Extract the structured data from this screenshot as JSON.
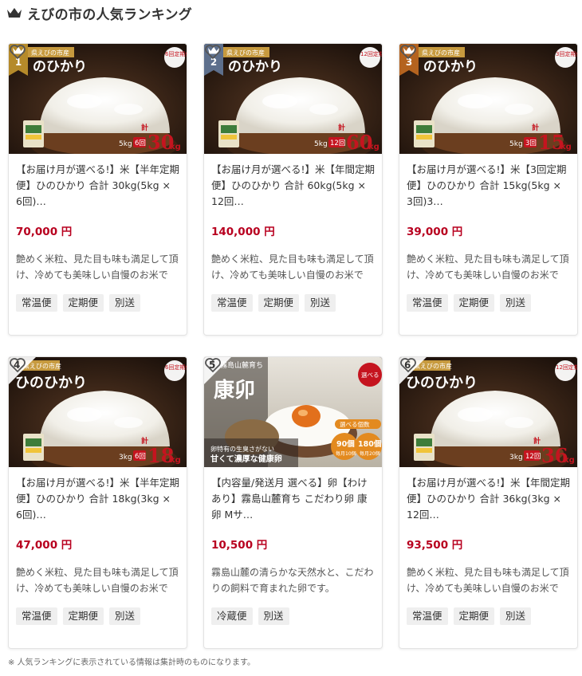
{
  "header": {
    "title": "えびの市の人気ランキング"
  },
  "colors": {
    "price": "#b8001f",
    "gold": "#b58a2a",
    "silver": "#5d6f8c",
    "bronze": "#b4631f"
  },
  "cards": [
    {
      "rank": "1",
      "rank_style": "gold",
      "image": {
        "brand": "県えびの市産",
        "name": "のひかり",
        "sub": "6回定期便",
        "unit": "5kg",
        "times": "6回",
        "total_prefix": "計",
        "total": "30",
        "total_unit": "kg"
      },
      "title": "【お届け月が選べる!】米【半年定期便】ひのひかり 合計 30kg(5kg × 6回)…",
      "price": "70,000 円",
      "desc": "艶めく米粒、見た目も味も満足して頂け、冷めても美味しい自慢のお米です。",
      "tags": [
        "常温便",
        "定期便",
        "別送"
      ]
    },
    {
      "rank": "2",
      "rank_style": "silver",
      "image": {
        "brand": "県えびの市産",
        "name": "のひかり",
        "sub": "12回定期便",
        "unit": "5kg",
        "times": "12回",
        "total_prefix": "計",
        "total": "60",
        "total_unit": "kg"
      },
      "title": "【お届け月が選べる!】米【年間定期便】ひのひかり 合計 60kg(5kg × 12回…",
      "price": "140,000 円",
      "desc": "艶めく米粒、見た目も味も満足して頂け、冷めても美味しい自慢のお米です。",
      "tags": [
        "常温便",
        "定期便",
        "別送"
      ]
    },
    {
      "rank": "3",
      "rank_style": "bronze",
      "image": {
        "brand": "県えびの市産",
        "name": "のひかり",
        "sub": "3回定期便",
        "unit": "5kg",
        "times": "3回",
        "total_prefix": "計",
        "total": "15",
        "total_unit": "kg"
      },
      "title": "【お届け月が選べる!】米【3回定期便】ひのひかり 合計 15kg(5kg × 3回)3…",
      "price": "39,000 円",
      "desc": "艶めく米粒、見た目も味も満足して頂け、冷めても美味しい自慢のお米です。",
      "tags": [
        "常温便",
        "定期便",
        "別送"
      ]
    },
    {
      "rank": "4",
      "rank_style": "plain",
      "image": {
        "brand": "崎県えびの市産",
        "name": "ひのひかり",
        "sub": "6回定期便",
        "unit": "3kg",
        "times": "6回",
        "total_prefix": "計",
        "total": "18",
        "total_unit": "kg"
      },
      "title": "【お届け月が選べる!】米【半年定期便】ひのひかり 合計 18kg(3kg × 6回)…",
      "price": "47,000 円",
      "desc": "艶めく米粒、見た目も味も満足して頂け、冷めても美味しい自慢のお米です。",
      "tags": [
        "常温便",
        "定期便",
        "別送"
      ]
    },
    {
      "rank": "5",
      "rank_style": "plain",
      "image": {
        "brand": "霧島山麓育ち",
        "name": "康卯",
        "line1": "卵特有の生臭さがない",
        "line2": "甘くて濃厚な健康卵",
        "pick": "選べる個数",
        "opt1": "90個",
        "opt1b": "毎月10個",
        "opt2": "180個",
        "opt2b": "毎月20個",
        "badge": "選べる"
      },
      "title": "【内容量/発送月 選べる】卵【わけあり】霧島山麓育ち こだわり卵 康卵 Mサ…",
      "price": "10,500 円",
      "desc": "霧島山麓の清らかな天然水と、こだわりの飼料で育まれた卵です。",
      "tags": [
        "冷蔵便",
        "別送"
      ]
    },
    {
      "rank": "6",
      "rank_style": "plain",
      "image": {
        "brand": "崎県えびの市産",
        "name": "ひのひかり",
        "sub": "12回定期便",
        "unit": "3kg",
        "times": "12回",
        "total_prefix": "計",
        "total": "36",
        "total_unit": "kg"
      },
      "title": "【お届け月が選べる!】米【年間定期便】ひのひかり 合計 36kg(3kg × 12回…",
      "price": "93,500 円",
      "desc": "艶めく米粒、見た目も味も満足して頂け、冷めても美味しい自慢のお米です。",
      "tags": [
        "常温便",
        "定期便",
        "別送"
      ]
    }
  ],
  "footnote": "※ 人気ランキングに表示されている情報は集計時のものになります。"
}
